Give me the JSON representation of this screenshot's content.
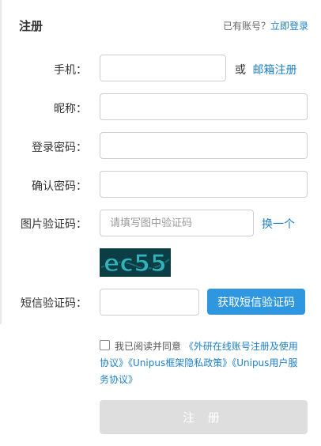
{
  "header": {
    "title": "注册",
    "has_account_text": "已有账号？",
    "login_link": "立即登录"
  },
  "form": {
    "phone_label": "手机：",
    "or_text": "或",
    "email_link": "邮箱注册",
    "nickname_label": "昵称：",
    "password_label": "登录密码：",
    "confirm_label": "确认密码：",
    "captcha_label": "图片验证码：",
    "captcha_placeholder": "请填写图中验证码",
    "captcha_refresh": "换一个",
    "captcha_text": "ec55",
    "sms_label": "短信验证码：",
    "sms_button": "获取短信验证码"
  },
  "agreement": {
    "prefix": "我已阅读并同意",
    "doc1": "《外研在线账号注册及使用协议》",
    "doc2": "《Unipus框架隐私政策》",
    "doc3": "《Unipus用户服务协议》"
  },
  "submit": {
    "label": "注 册"
  },
  "colors": {
    "link": "#1f7fc4",
    "primary_button": "#2f97df",
    "submit_disabled": "#dedede",
    "captcha_bg": "#0b3d44",
    "captcha_glyph": "#2fb3bd"
  }
}
